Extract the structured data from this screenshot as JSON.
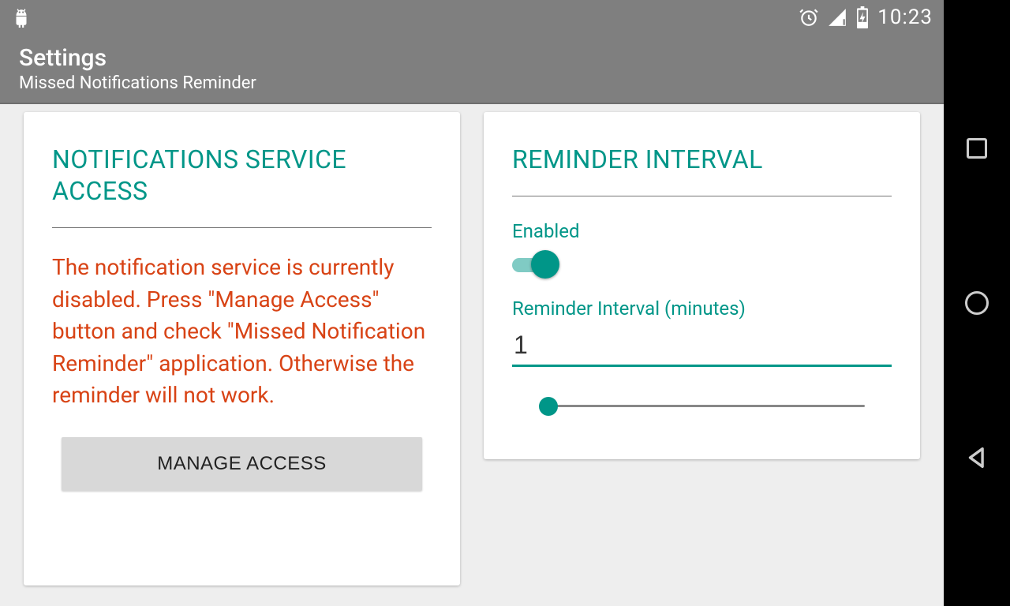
{
  "status": {
    "time": "10:23"
  },
  "appbar": {
    "title": "Settings",
    "subtitle": "Missed Notifications Reminder"
  },
  "card1": {
    "title": "NOTIFICATIONS SERVICE ACCESS",
    "warning": "The notification service is currently disabled. Press \"Manage Access\" button and check \"Missed Notification Reminder\" application. Otherwise the reminder will not work.",
    "button": "MANAGE ACCESS"
  },
  "card2": {
    "title": "REMINDER INTERVAL",
    "enabled_label": "Enabled",
    "enabled_value": true,
    "interval_label": "Reminder Interval (minutes)",
    "interval_value": "1",
    "slider_min": 1,
    "slider_max": 60,
    "slider_value": 1
  },
  "colors": {
    "accent": "#009688",
    "warning_text": "#d84315",
    "header_bg": "#7f7f7f"
  }
}
